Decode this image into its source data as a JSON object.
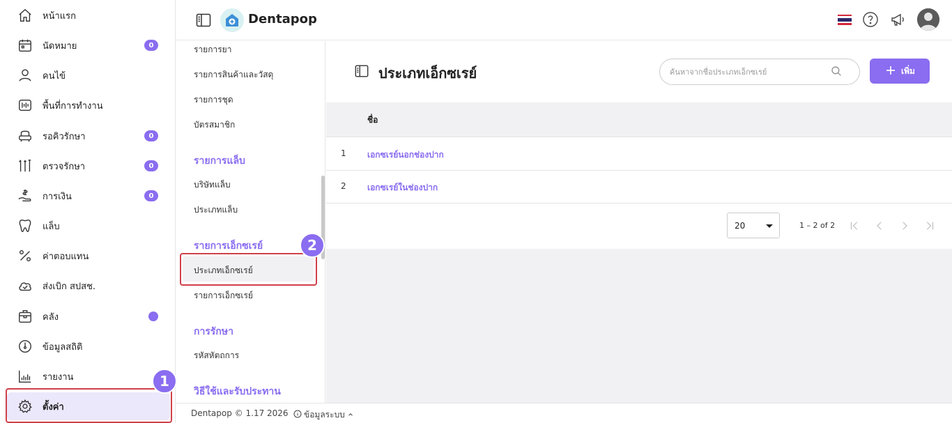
{
  "sidebar": {
    "items": [
      {
        "label": "หน้าแรก",
        "icon": "home-icon"
      },
      {
        "label": "นัดหมาย",
        "icon": "calendar-icon",
        "badge": "0"
      },
      {
        "label": "คนไข้",
        "icon": "user-icon"
      },
      {
        "label": "พื้นที่การทำงาน",
        "icon": "workspace-icon"
      },
      {
        "label": "รอคิวรักษา",
        "icon": "dental-chair-icon",
        "badge": "0"
      },
      {
        "label": "ตรวจรักษา",
        "icon": "dental-tools-icon",
        "badge": "0"
      },
      {
        "label": "การเงิน",
        "icon": "money-hand-icon",
        "badge": "0"
      },
      {
        "label": "แล็บ",
        "icon": "tooth-icon"
      },
      {
        "label": "ค่าตอบแทน",
        "icon": "percent-icon"
      },
      {
        "label": "ส่งเบิก สปสช.",
        "icon": "cloud-check-icon"
      },
      {
        "label": "คลัง",
        "icon": "box-icon"
      },
      {
        "label": "ข้อมูลสถิติ",
        "icon": "gauge-icon"
      },
      {
        "label": "รายงาน",
        "icon": "bar-chart-icon"
      },
      {
        "label": "ตั้งค่า",
        "icon": "gear-icon"
      }
    ]
  },
  "topbar": {
    "brand": "Dentapop",
    "icons": [
      "thai-flag-icon",
      "help-icon",
      "megaphone-icon",
      "avatar"
    ]
  },
  "submenu": {
    "items": {
      "drug_list": "รายการยา",
      "product_list": "รายการสินค้าและวัสดุ",
      "set_list": "รายการชุด",
      "member_card": "บัตรสมาชิก",
      "lab_section": "รายการแล็บ",
      "lab_company": "บริษัทแล็บ",
      "lab_type": "ประเภทแล็บ",
      "xray_section": "รายการเอ็กซเรย์",
      "xray_type": "ประเภทเอ็กซเรย์",
      "xray_list": "รายการเอ็กซเรย์",
      "treatment_section": "การรักษา",
      "procedure_code": "รหัสหัตถการ",
      "usage_section": "วิธีใช้และรับประทาน"
    }
  },
  "main": {
    "title": "ประเภทเอ็กซเรย์",
    "search_placeholder": "ค้นหาจากชื่อประเภทเอ็กซเรย์",
    "add_label": "เพิ่ม",
    "table": {
      "header_name": "ชื่อ",
      "rows": [
        {
          "index": "1",
          "name": "เอกซเรย์นอกช่องปาก"
        },
        {
          "index": "2",
          "name": "เอกซเรย์ในช่องปาก"
        }
      ]
    },
    "pager": {
      "page_size": "20",
      "range": "1 – 2 of 2"
    }
  },
  "footer": {
    "copyright": "Dentapop © 1.17 2026",
    "system_info": "ข้อมูลระบบ"
  },
  "callouts": {
    "first": "1",
    "second": "2"
  },
  "colors": {
    "accent": "#8a6df0",
    "callout_border": "#d0404a"
  }
}
